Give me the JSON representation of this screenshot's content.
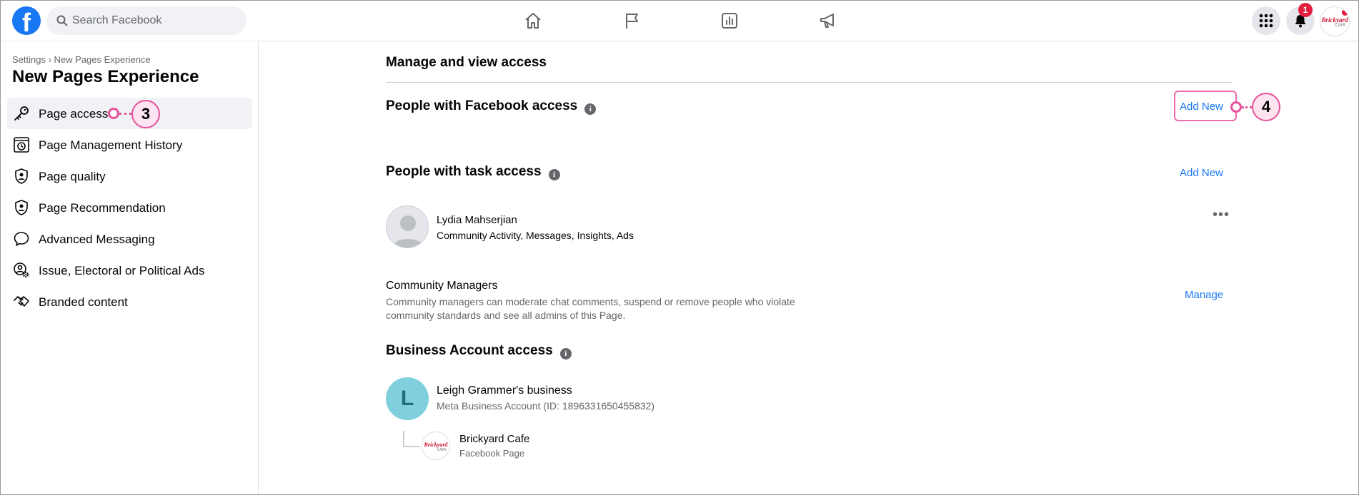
{
  "topbar": {
    "logo_letter": "f",
    "search_placeholder": "Search Facebook",
    "notification_count": "1",
    "nav_icons": [
      "home-icon",
      "flag-icon",
      "insights-icon",
      "megaphone-icon"
    ],
    "avatar_brand": "Brickyard",
    "avatar_brand_sub": "CAFE"
  },
  "sidebar": {
    "breadcrumb": "Settings › New Pages Experience",
    "title": "New Pages Experience",
    "items": [
      {
        "label": "Page access",
        "icon": "key-icon",
        "active": true
      },
      {
        "label": "Page Management History",
        "icon": "history-icon",
        "active": false
      },
      {
        "label": "Page quality",
        "icon": "shield-person-icon",
        "active": false
      },
      {
        "label": "Page Recommendation",
        "icon": "shield-person-icon",
        "active": false
      },
      {
        "label": "Advanced Messaging",
        "icon": "chat-bubble-icon",
        "active": false
      },
      {
        "label": "Issue, Electoral or Political Ads",
        "icon": "person-gear-icon",
        "active": false
      },
      {
        "label": "Branded content",
        "icon": "handshake-icon",
        "active": false
      }
    ]
  },
  "callouts": {
    "sidebar_step": "3",
    "add_new_step": "4"
  },
  "main": {
    "section_title": "Manage and view access",
    "facebook_access": {
      "title": "People with Facebook access",
      "info": "i",
      "action": "Add New"
    },
    "task_access": {
      "title": "People with task access",
      "info": "i",
      "action": "Add New",
      "person": {
        "name": "Lydia Mahserjian",
        "tasks": "Community Activity, Messages, Insights, Ads",
        "more": "•••"
      }
    },
    "community": {
      "title": "Community Managers",
      "description": "Community managers can moderate chat comments, suspend or remove people who violate community standards and see all admins of this Page.",
      "action": "Manage"
    },
    "business": {
      "title": "Business Account access",
      "info": "i",
      "account": {
        "initial": "L",
        "name": "Leigh Grammer's business",
        "sub": "Meta Business Account (ID: 1896331650455832)"
      },
      "page": {
        "name": "Brickyard Cafe",
        "sub": "Facebook Page",
        "logo_text": "Brickyard",
        "logo_sub": "CAFE"
      }
    }
  },
  "colors": {
    "accent": "#1877f2",
    "callout": "#e8529b",
    "badge": "#e41e3f"
  }
}
